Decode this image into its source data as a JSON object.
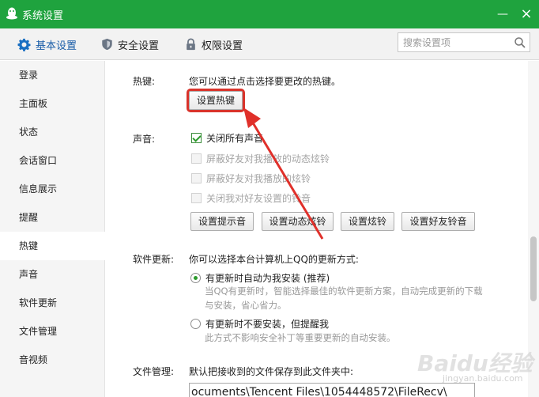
{
  "window": {
    "title": "系统设置",
    "minimize": "—",
    "close": "×"
  },
  "tabs": [
    {
      "label": "基本设置",
      "icon": "gear-icon"
    },
    {
      "label": "安全设置",
      "icon": "shield-icon"
    },
    {
      "label": "权限设置",
      "icon": "lock-icon"
    }
  ],
  "search": {
    "placeholder": "搜索设置项"
  },
  "sidebar": {
    "items": [
      "登录",
      "主面板",
      "状态",
      "会话窗口",
      "信息展示",
      "提醒",
      "热键",
      "声音",
      "软件更新",
      "文件管理",
      "音视频"
    ],
    "active": "热键"
  },
  "hotkey": {
    "label": "热键:",
    "desc": "您可以通过点击选择要更改的热键。",
    "button": "设置热键"
  },
  "sound": {
    "label": "声音:",
    "options": [
      {
        "label": "关闭所有声音",
        "checked": true,
        "enabled": true
      },
      {
        "label": "屏蔽好友对我播放的动态炫铃",
        "checked": false,
        "enabled": false
      },
      {
        "label": "屏蔽好友对我播放的炫铃",
        "checked": false,
        "enabled": false
      },
      {
        "label": "关闭我对好友设置的铃音",
        "checked": false,
        "enabled": false
      }
    ],
    "buttons": [
      "设置提示音",
      "设置动态炫铃",
      "设置炫铃",
      "设置好友铃音"
    ]
  },
  "update": {
    "label": "软件更新:",
    "desc": "你可以选择本台计算机上QQ的更新方式:",
    "options": [
      {
        "label": "有更新时自动为我安装 (推荐)",
        "hint1": "当QQ有更新时，智能选择最佳的软件更新方案，自动完成更新的下载",
        "hint2": "与安装，省心省力。",
        "checked": true
      },
      {
        "label": "有更新时不要安装，但提醒我",
        "hint1": "此方式不影响安全补丁等重要更新的自动安装。",
        "checked": false
      }
    ]
  },
  "files": {
    "label": "文件管理:",
    "desc": "默认把接收到的文件保存到此文件夹中:",
    "path": "ocuments\\Tencent Files\\1054448572\\FileRecv\\"
  },
  "watermark": {
    "text": "Baidu经验",
    "sub": "jingyan.baidu.com"
  },
  "colors": {
    "titlebar": "#1fa33e",
    "active_tab": "#1a5da8",
    "highlight": "#d9332b"
  }
}
